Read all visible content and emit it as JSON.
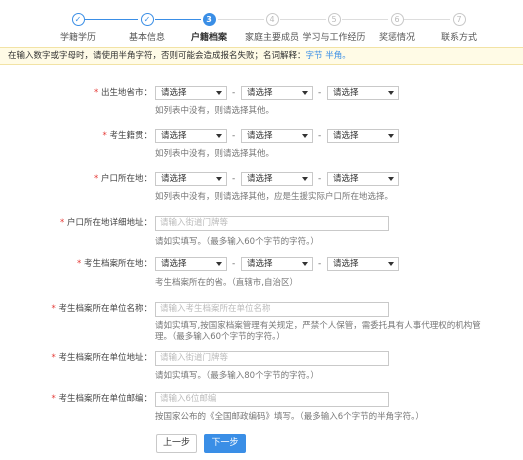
{
  "steps": [
    {
      "label": "学籍学历",
      "marker": "✓"
    },
    {
      "label": "基本信息",
      "marker": "✓"
    },
    {
      "label": "户籍档案",
      "marker": "3"
    },
    {
      "label": "家庭主要成员",
      "marker": "4"
    },
    {
      "label": "学习与工作经历",
      "marker": "5"
    },
    {
      "label": "奖惩情况",
      "marker": "6"
    },
    {
      "label": "联系方式",
      "marker": "7"
    }
  ],
  "notice": {
    "text": "在输入数字或字母时，请使用半角字符，否则可能会造成报名失败；名词解释：",
    "eg": "字节 半角。"
  },
  "select_placeholder": "请选择",
  "form": {
    "birthplace": {
      "label": "出生地省市：",
      "hint": "如列表中没有，则请选择其他。"
    },
    "native": {
      "label": "考生籍贯：",
      "hint": "如列表中没有，则请选择其他。"
    },
    "hukou": {
      "label": "户口所在地：",
      "hint": "如列表中没有，则请选择其他，应是生援实际户口所在地选择。"
    },
    "hukou_addr": {
      "label": "户口所在地详细地址：",
      "placeholder": "请输入街道门牌等",
      "hint": "请如实填写。（最多输入60个字节的字符。）"
    },
    "archive_loc": {
      "label": "考生档案所在地：",
      "hint": "考生档案所在的省。（直辖市,自治区）"
    },
    "archive_unit": {
      "label": "考生档案所在单位名称：",
      "placeholder": "请输入考生档案所在单位名称",
      "hint1": "请如实填写,按国家档案管理有关规定，严禁个人保管，需委托具有人事代理权的机构管",
      "hint2": "理。（最多输入60个字节的字符。）"
    },
    "archive_addr": {
      "label": "考生档案所在单位地址：",
      "placeholder": "请输入街道门牌等",
      "hint": "请如实填写。（最多输入80个字节的字符。）"
    },
    "archive_zip": {
      "label": "考生档案所在单位邮编：",
      "placeholder": "请输入6位邮编",
      "hint": "按国家公布的《全国邮政编码》填写。（最多输入6个字节的半角字符。）"
    }
  },
  "buttons": {
    "prev": "上一步",
    "next": "下一步"
  }
}
